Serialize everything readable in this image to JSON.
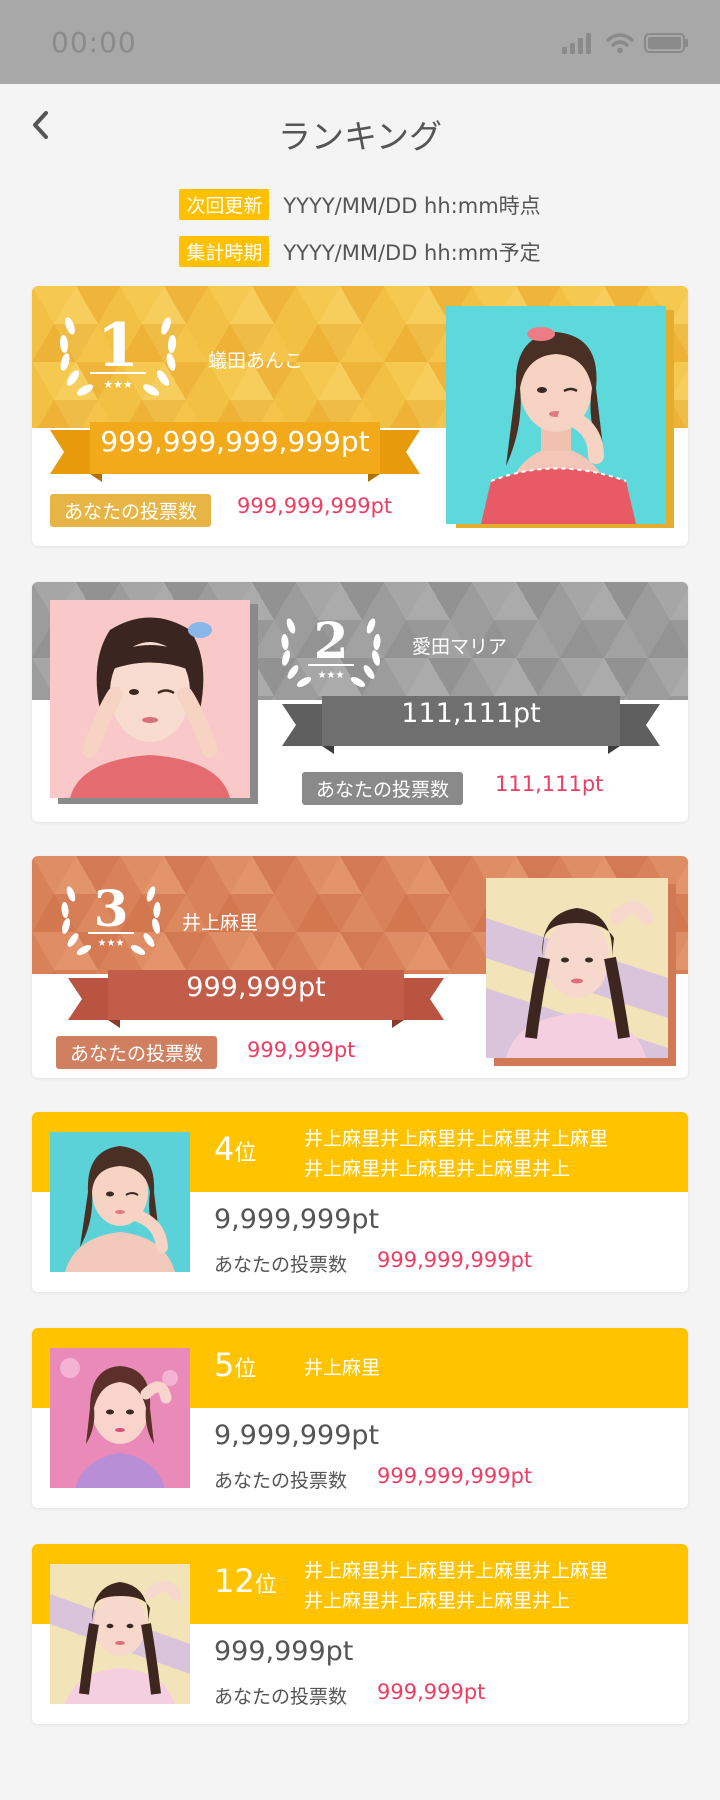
{
  "status": {
    "time": "00:00"
  },
  "header": {
    "title": "ランキング"
  },
  "info": {
    "next_update_label": "次回更新",
    "next_update_value": "YYYY/MM/DD hh:mm時点",
    "tally_label": "集計時期",
    "tally_value": "YYYY/MM/DD hh:mm予定"
  },
  "top_ranks": [
    {
      "rank": "1",
      "name": "蟻田あんこ",
      "points": "999,999,999,999pt",
      "vote_label": "あなたの投票数",
      "vote_value": "999,999,999pt",
      "color": "#f0b93a"
    },
    {
      "rank": "2",
      "name": "愛田マリア",
      "points": "111,111pt",
      "vote_label": "あなたの投票数",
      "vote_value": "111,111pt",
      "color": "#9a9a9a"
    },
    {
      "rank": "3",
      "name": "井上麻里",
      "points": "999,999pt",
      "vote_label": "あなたの投票数",
      "vote_value": "999,999pt",
      "color": "#d88058"
    }
  ],
  "other_ranks": [
    {
      "rank_num": "4",
      "rank_suffix": "位",
      "name": "井上麻里井上麻里井上麻里井上麻里井上麻里井上麻里井上麻里井上",
      "points": "9,999,999pt",
      "vote_label": "あなたの投票数",
      "vote_value": "999,999,999pt"
    },
    {
      "rank_num": "5",
      "rank_suffix": "位",
      "name": "井上麻里",
      "points": "9,999,999pt",
      "vote_label": "あなたの投票数",
      "vote_value": "999,999,999pt"
    },
    {
      "rank_num": "12",
      "rank_suffix": "位",
      "name": "井上麻里井上麻里井上麻里井上麻里井上麻里井上麻里井上麻里井上",
      "points": "999,999pt",
      "vote_label": "あなたの投票数",
      "vote_value": "999,999pt"
    }
  ],
  "colors": {
    "accent": "#ffc000",
    "points_pink": "#ee3d63",
    "gold": "#f0b93a",
    "silver": "#9a9a9a",
    "bronze": "#d88058"
  }
}
